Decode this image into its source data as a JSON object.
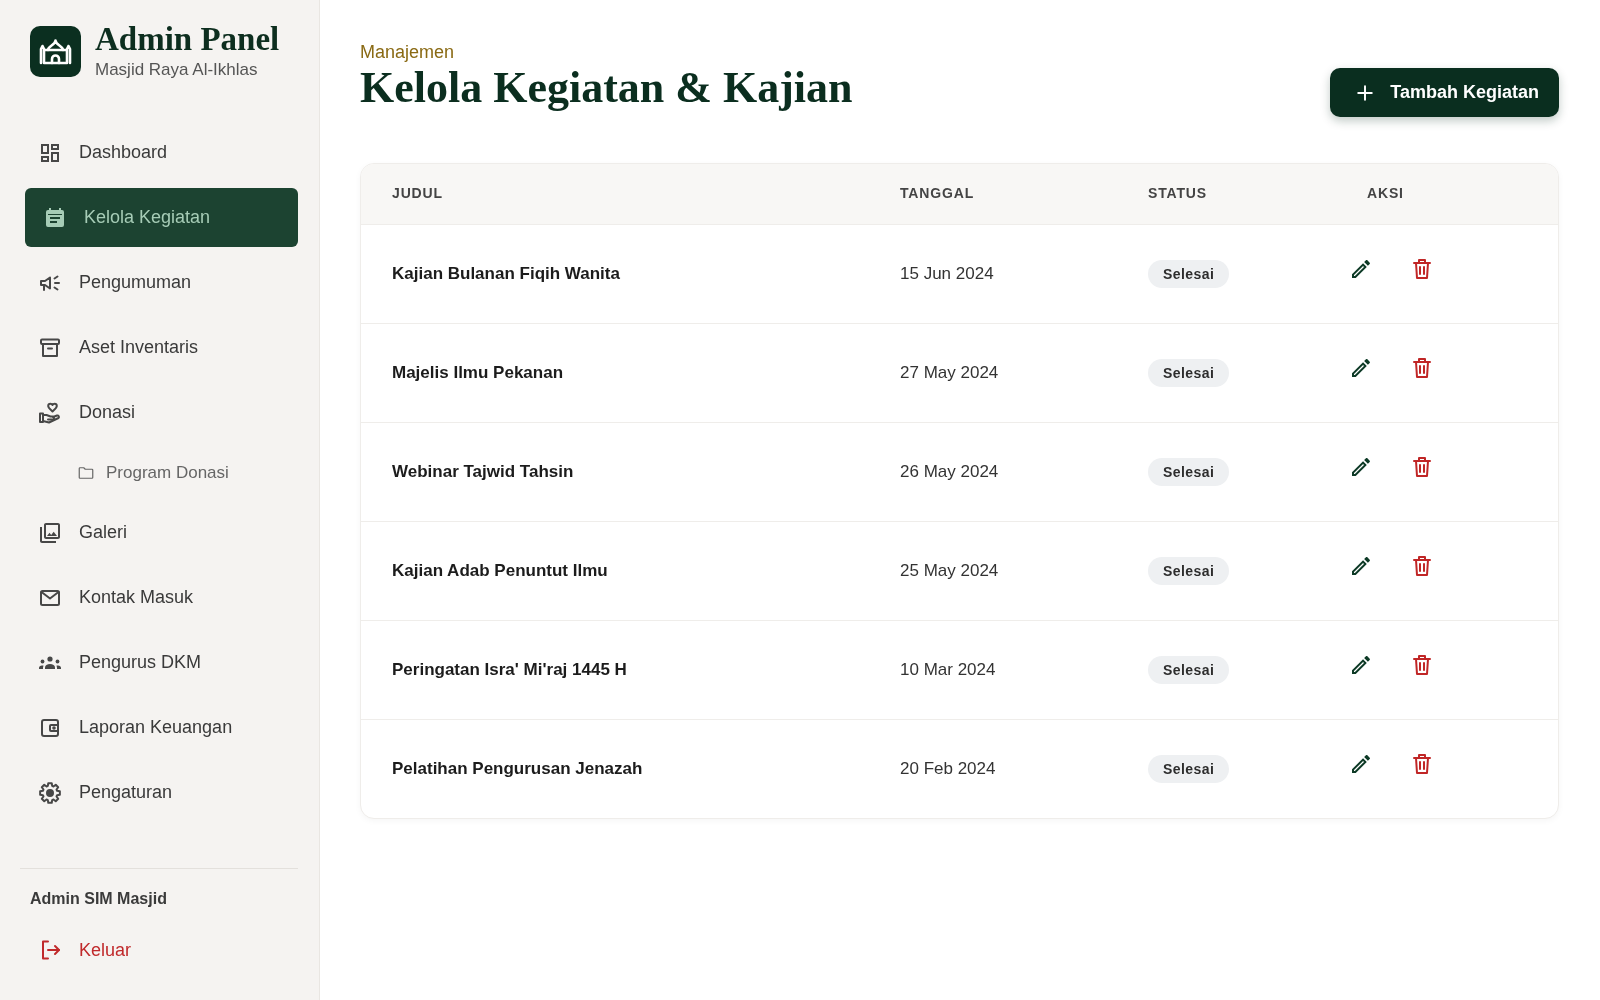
{
  "sidebar": {
    "brand": {
      "title": "Admin Panel",
      "subtitle": "Masjid Raya Al-Ikhlas"
    },
    "items": [
      {
        "label": "Dashboard",
        "selected": false
      },
      {
        "label": "Kelola Kegiatan",
        "selected": true
      },
      {
        "label": "Pengumuman",
        "selected": false
      },
      {
        "label": "Aset Inventaris",
        "selected": false
      },
      {
        "label": "Donasi",
        "selected": false,
        "children": [
          {
            "label": "Program Donasi",
            "selected": false
          }
        ]
      },
      {
        "label": "Galeri",
        "selected": false
      },
      {
        "label": "Kontak Masuk",
        "selected": false
      },
      {
        "label": "Pengurus DKM",
        "selected": false
      },
      {
        "label": "Laporan Keuangan",
        "selected": false
      },
      {
        "label": "Pengaturan",
        "selected": false
      }
    ],
    "user": "Admin SIM Masjid",
    "logout": "Keluar"
  },
  "header": {
    "eyebrow": "Manajemen",
    "title": "Kelola Kegiatan & Kajian",
    "add_button": "Tambah Kegiatan"
  },
  "table": {
    "columns": [
      "JUDUL",
      "TANGGAL",
      "STATUS",
      "AKSI"
    ],
    "rows": [
      {
        "title": "Kajian Bulanan Fiqih Wanita",
        "date": "15 Jun 2024",
        "status": "Selesai"
      },
      {
        "title": "Majelis Ilmu Pekanan",
        "date": "27 May 2024",
        "status": "Selesai"
      },
      {
        "title": "Webinar Tajwid Tahsin",
        "date": "26 May 2024",
        "status": "Selesai"
      },
      {
        "title": "Kajian Adab Penuntut Ilmu",
        "date": "25 May 2024",
        "status": "Selesai"
      },
      {
        "title": "Peringatan Isra' Mi'raj 1445 H",
        "date": "10 Mar 2024",
        "status": "Selesai"
      },
      {
        "title": "Pelatihan Pengurusan Jenazah",
        "date": "20 Feb 2024",
        "status": "Selesai"
      }
    ]
  }
}
